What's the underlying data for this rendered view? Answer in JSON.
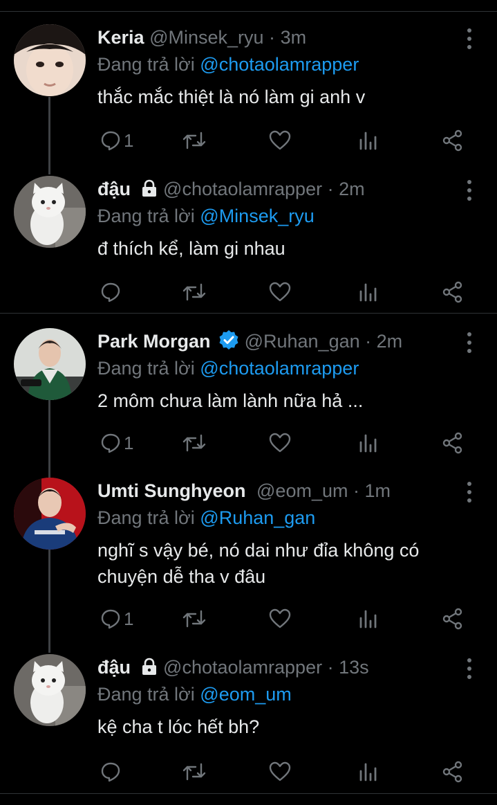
{
  "tweets": [
    {
      "name": "Keria",
      "handle": "@Minsek_ryu",
      "time": "3m",
      "reply_prefix": "Đang trả lời",
      "reply_to": "@chotaolamrapper",
      "text": "thắc mắc thiệt là nó làm gi anh v",
      "reply_count": "1",
      "locked": false,
      "verified": false,
      "avatar": "boy-face-avatar"
    },
    {
      "name": "đậu",
      "handle": "@chotaolamrapper",
      "time": "2m",
      "reply_prefix": "Đang trả lời",
      "reply_to": "@Minsek_ryu",
      "text": "đ thích kể, làm gi nhau",
      "reply_count": "",
      "locked": true,
      "verified": false,
      "avatar": "white-cat-avatar"
    },
    {
      "name": "Park Morgan",
      "handle": "@Ruhan_gan",
      "time": "2m",
      "reply_prefix": "Đang trả lời",
      "reply_to": "@chotaolamrapper",
      "text": "2 môm chưa làm lành nữa hả ...",
      "reply_count": "1",
      "locked": false,
      "verified": true,
      "avatar": "esports-player-avatar"
    },
    {
      "name": "Umti Sunghyeon",
      "handle": "@eom_um",
      "time": "1m",
      "reply_prefix": "Đang trả lời",
      "reply_to": "@Ruhan_gan",
      "text": "nghĩ s vậy bé, nó dai như đỉa không có\nchuyện dễ tha v đâu",
      "reply_count": "1",
      "locked": false,
      "verified": false,
      "avatar": "player-jersey-avatar"
    },
    {
      "name": "đậu",
      "handle": "@chotaolamrapper",
      "time": "13s",
      "reply_prefix": "Đang trả lời",
      "reply_to": "@eom_um",
      "text": "kệ cha t lóc hết bh?",
      "reply_count": "",
      "locked": true,
      "verified": false,
      "avatar": "white-cat-avatar"
    }
  ],
  "separator": "·",
  "colors": {
    "background": "#000000",
    "text": "#e7e9ea",
    "muted": "#71767b",
    "mention": "#1d9bf0",
    "verified": "#1d9bf0"
  }
}
